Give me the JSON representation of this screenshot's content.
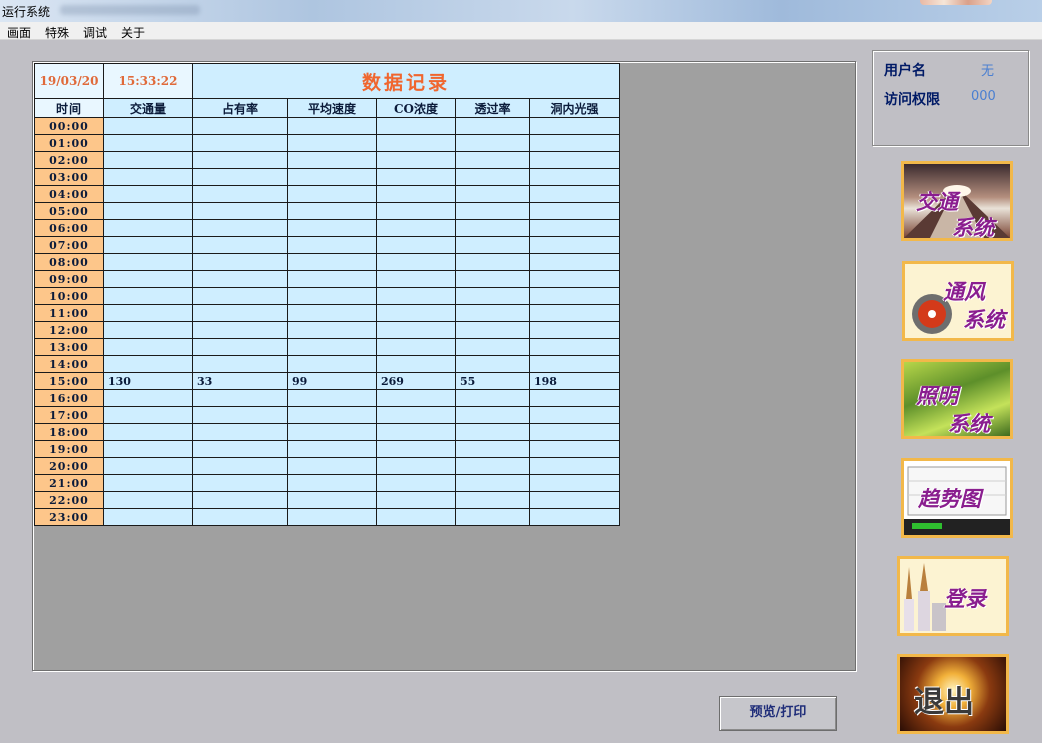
{
  "window": {
    "title": "运行系统"
  },
  "menu": [
    "画面",
    "特殊",
    "调试",
    "关于"
  ],
  "record": {
    "date": "19/03/20",
    "time": "15:33:22",
    "title": "数据记录",
    "headers": [
      "时间",
      "交通量",
      "占有率",
      "平均速度",
      "CO浓度",
      "透过率",
      "洞内光强"
    ],
    "rows": [
      {
        "hour": "00:00",
        "cells": [
          "",
          "",
          "",
          "",
          "",
          ""
        ]
      },
      {
        "hour": "01:00",
        "cells": [
          "",
          "",
          "",
          "",
          "",
          ""
        ]
      },
      {
        "hour": "02:00",
        "cells": [
          "",
          "",
          "",
          "",
          "",
          ""
        ]
      },
      {
        "hour": "03:00",
        "cells": [
          "",
          "",
          "",
          "",
          "",
          ""
        ]
      },
      {
        "hour": "04:00",
        "cells": [
          "",
          "",
          "",
          "",
          "",
          ""
        ]
      },
      {
        "hour": "05:00",
        "cells": [
          "",
          "",
          "",
          "",
          "",
          ""
        ]
      },
      {
        "hour": "06:00",
        "cells": [
          "",
          "",
          "",
          "",
          "",
          ""
        ]
      },
      {
        "hour": "07:00",
        "cells": [
          "",
          "",
          "",
          "",
          "",
          ""
        ]
      },
      {
        "hour": "08:00",
        "cells": [
          "",
          "",
          "",
          "",
          "",
          ""
        ]
      },
      {
        "hour": "09:00",
        "cells": [
          "",
          "",
          "",
          "",
          "",
          ""
        ]
      },
      {
        "hour": "10:00",
        "cells": [
          "",
          "",
          "",
          "",
          "",
          ""
        ]
      },
      {
        "hour": "11:00",
        "cells": [
          "",
          "",
          "",
          "",
          "",
          ""
        ]
      },
      {
        "hour": "12:00",
        "cells": [
          "",
          "",
          "",
          "",
          "",
          ""
        ]
      },
      {
        "hour": "13:00",
        "cells": [
          "",
          "",
          "",
          "",
          "",
          ""
        ]
      },
      {
        "hour": "14:00",
        "cells": [
          "",
          "",
          "",
          "",
          "",
          ""
        ]
      },
      {
        "hour": "15:00",
        "cells": [
          "130",
          "33",
          "99",
          "269",
          "55",
          "198"
        ]
      },
      {
        "hour": "16:00",
        "cells": [
          "",
          "",
          "",
          "",
          "",
          ""
        ]
      },
      {
        "hour": "17:00",
        "cells": [
          "",
          "",
          "",
          "",
          "",
          ""
        ]
      },
      {
        "hour": "18:00",
        "cells": [
          "",
          "",
          "",
          "",
          "",
          ""
        ]
      },
      {
        "hour": "19:00",
        "cells": [
          "",
          "",
          "",
          "",
          "",
          ""
        ]
      },
      {
        "hour": "20:00",
        "cells": [
          "",
          "",
          "",
          "",
          "",
          ""
        ]
      },
      {
        "hour": "21:00",
        "cells": [
          "",
          "",
          "",
          "",
          "",
          ""
        ]
      },
      {
        "hour": "22:00",
        "cells": [
          "",
          "",
          "",
          "",
          "",
          ""
        ]
      },
      {
        "hour": "23:00",
        "cells": [
          "",
          "",
          "",
          "",
          "",
          ""
        ]
      }
    ]
  },
  "user": {
    "name_label": "用户名",
    "name_value": "无",
    "access_label": "访问权限",
    "access_value": "000"
  },
  "nav": {
    "traffic": [
      "交通",
      "系统"
    ],
    "ventilation": [
      "通风",
      "系统"
    ],
    "lighting": [
      "照明",
      "系统"
    ],
    "trend": "趋势图",
    "login": "登录",
    "exit": "退出"
  },
  "print_button": "预览/打印",
  "colors": {
    "cell_bg": "#cfeeff",
    "hour_bg": "#fdc68a",
    "title_color": "#f0662e",
    "nav_border": "#f2b84a",
    "nav_caption": "#8a1e8f"
  }
}
